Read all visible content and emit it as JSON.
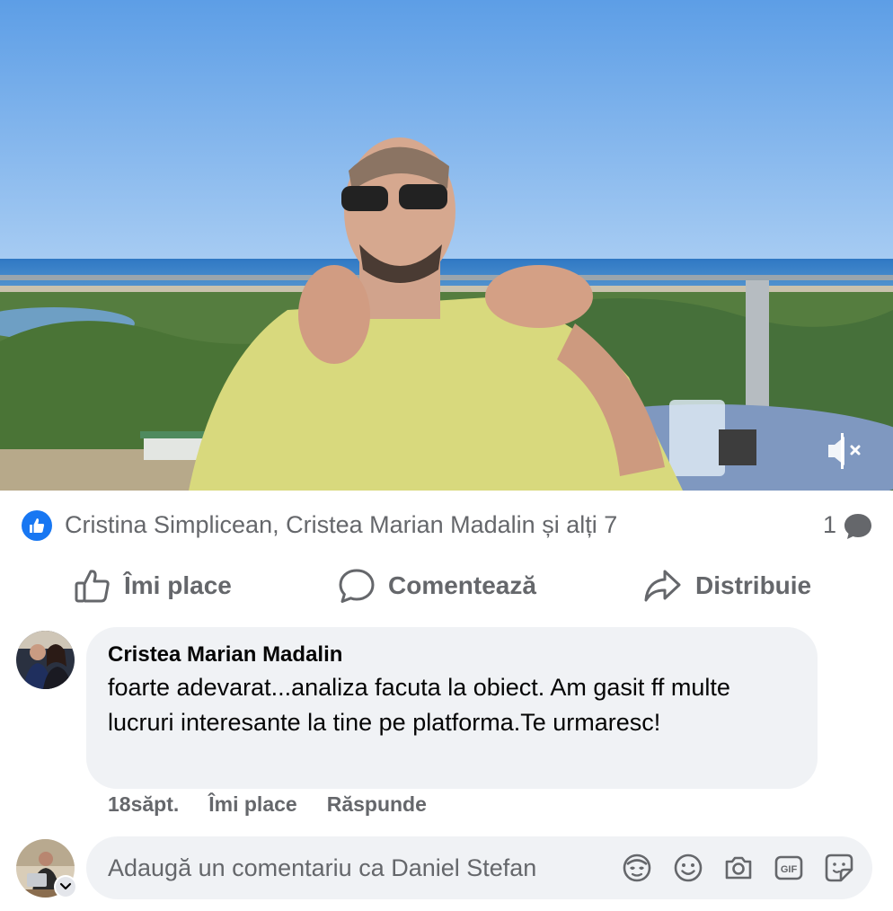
{
  "video": {
    "scene_colors": {
      "sky_top": "#5d9ee6",
      "sky_bottom": "#a9cdf3",
      "sea": "#3f86c8",
      "trees": "#4f7a3c",
      "shirt": "#d7d77a",
      "table": "#8ea5c9"
    },
    "mute_icon": "muted-speaker-icon"
  },
  "reactions": {
    "like_icon": "like-thumb-icon",
    "reactors_text": "Cristina Simplicean, Cristea Marian Madalin și alți 7",
    "comment_count": "1",
    "comment_count_icon": "comment-bubble-icon"
  },
  "actions": {
    "like_label": "Îmi place",
    "comment_label": "Comentează",
    "share_label": "Distribuie"
  },
  "comment": {
    "author": "Cristea Marian Madalin",
    "text": "foarte adevarat...analiza facuta la obiect. Am gasit ff multe lucruri interesante la tine pe platforma.Te urmaresc!",
    "time": "18săpt.",
    "like_label": "Îmi place",
    "reply_label": "Răspunde"
  },
  "composer": {
    "placeholder": "Adaugă un comentariu ca Daniel Stefan",
    "icons": [
      "avatar-sticker-icon",
      "emoji-icon",
      "camera-icon",
      "gif-icon",
      "sticker-icon"
    ]
  },
  "colors": {
    "brand_blue": "#1877f2",
    "secondary_text": "#65676b",
    "bubble_bg": "#f0f2f5"
  }
}
